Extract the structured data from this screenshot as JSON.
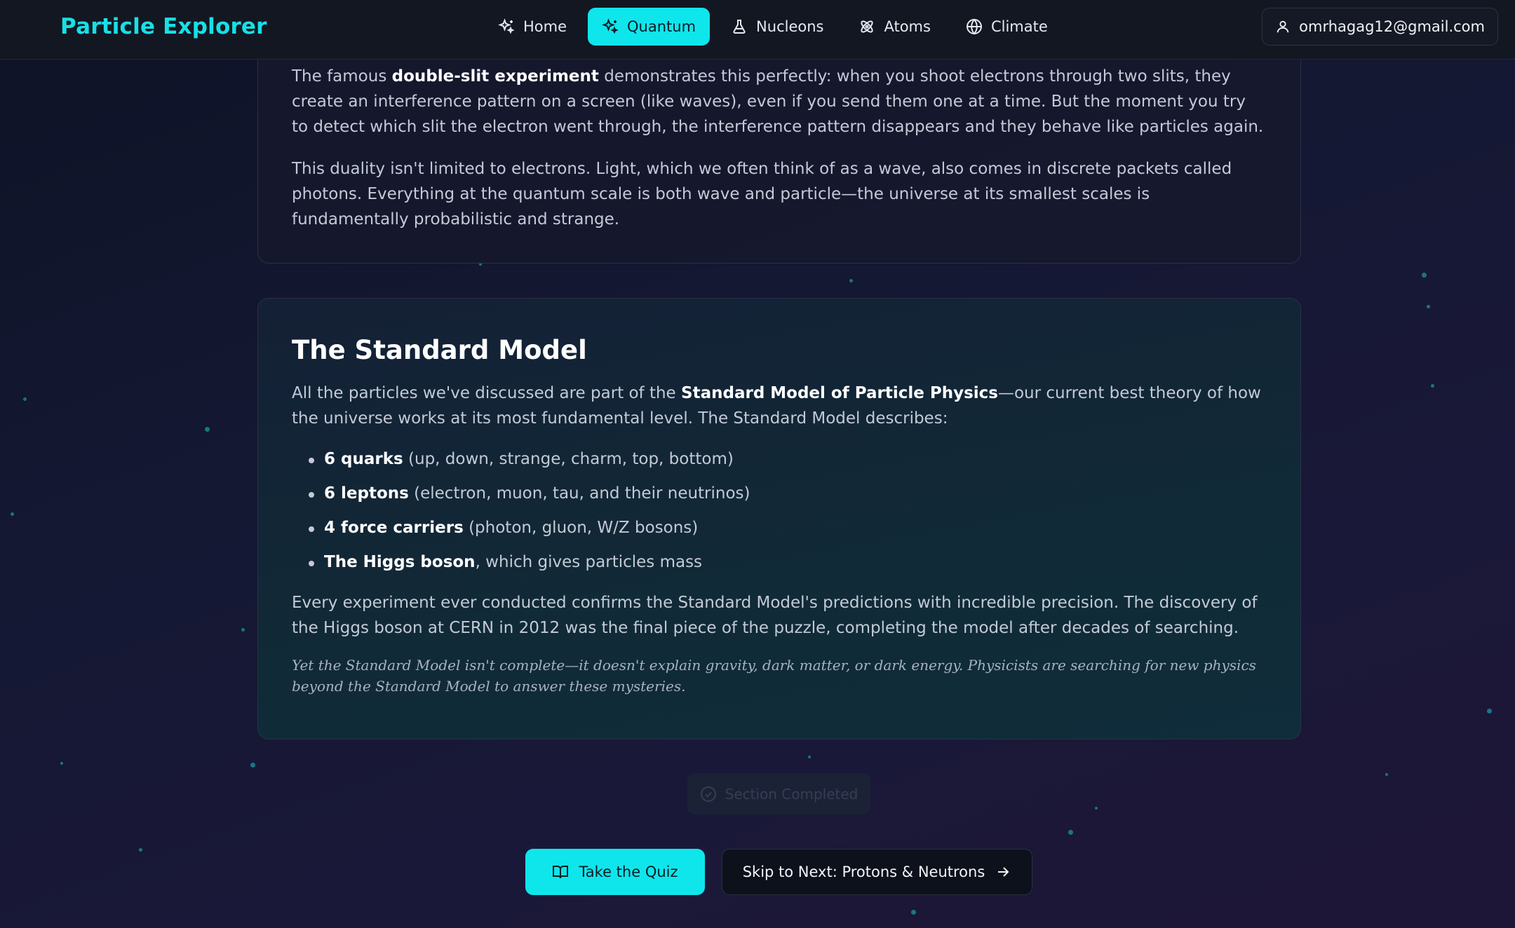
{
  "navbar": {
    "brand": "Particle Explorer",
    "links": [
      {
        "label": "Home",
        "icon": "sparkles-icon"
      },
      {
        "label": "Quantum",
        "icon": "sparkles-icon",
        "active": true
      },
      {
        "label": "Nucleons",
        "icon": "flask-icon"
      },
      {
        "label": "Atoms",
        "icon": "atom-icon"
      },
      {
        "label": "Climate",
        "icon": "globe-icon"
      }
    ],
    "account_email": "omrhagag12@gmail.com",
    "accent_color": "#0ee6ec"
  },
  "section_wave": {
    "p1_before": "The famous ",
    "p1_bold": "double-slit experiment",
    "p1_after": " demonstrates this perfectly: when you shoot electrons through two slits, they create an interference pattern on a screen (like waves), even if you send them one at a time. But the moment you try to detect which slit the electron went through, the interference pattern disappears and they behave like particles again.",
    "p2": "This duality isn't limited to electrons. Light, which we often think of as a wave, also comes in discrete packets called photons. Everything at the quantum scale is both wave and particle—the universe at its smallest scales is fundamentally probabilistic and strange."
  },
  "section_standard_model": {
    "title": "The Standard Model",
    "intro_before": "All the particles we've discussed are part of the ",
    "intro_bold": "Standard Model of Particle Physics",
    "intro_after": "—our current best theory of how the universe works at its most fundamental level. The Standard Model describes:",
    "bullets": [
      {
        "bold": "6 quarks",
        "rest": " (up, down, strange, charm, top, bottom)"
      },
      {
        "bold": "6 leptons",
        "rest": " (electron, muon, tau, and their neutrinos)"
      },
      {
        "bold": "4 force carriers",
        "rest": " (photon, gluon, W/Z bosons)"
      },
      {
        "bold": "The Higgs boson",
        "rest": ", which gives particles mass"
      }
    ],
    "p_confirm": "Every experiment ever conducted confirms the Standard Model's predictions with incredible precision. The discovery of the Higgs boson at CERN in 2012 was the final piece of the puzzle, completing the model after decades of searching.",
    "note": "Yet the Standard Model isn't complete—it doesn't explain gravity, dark matter, or dark energy. Physicists are searching for new physics beyond the Standard Model to answer these mysteries."
  },
  "status": {
    "completed_label": "Section Completed"
  },
  "actions": {
    "quiz_label": "Take the Quiz",
    "next_label": "Skip to Next: Protons & Neutrons"
  }
}
